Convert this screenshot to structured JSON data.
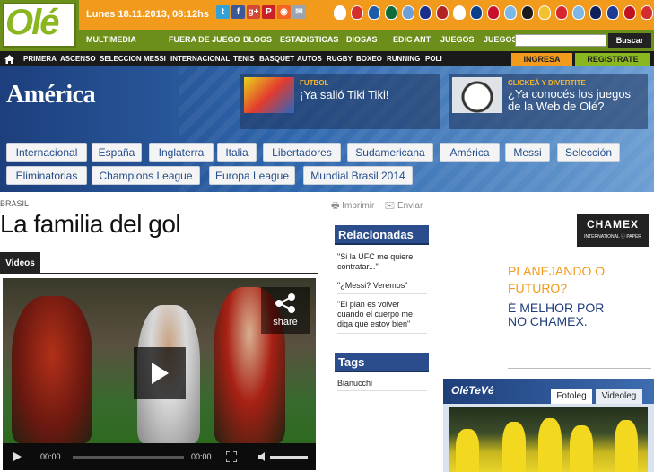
{
  "header": {
    "logo": "Olé",
    "date": "Lunes 18.11.2013, 08:12hs",
    "social_icons": [
      {
        "icon": "twitter-icon",
        "glyph": "t",
        "color": "#33a1d8"
      },
      {
        "icon": "facebook-icon",
        "glyph": "f",
        "color": "#3b5998"
      },
      {
        "icon": "google-plus-icon",
        "glyph": "g+",
        "color": "#d34836"
      },
      {
        "icon": "pinterest-icon",
        "glyph": "P",
        "color": "#cb2027"
      },
      {
        "icon": "rss-icon",
        "glyph": "◉",
        "color": "#f26522"
      },
      {
        "icon": "mail-icon",
        "glyph": "✉",
        "color": "#9aa4b1"
      }
    ],
    "crests": [
      "#ffffff",
      "#d62d2d",
      "#1b5caa",
      "#0f6c3a",
      "#6f9fd8",
      "#1a2f8a",
      "#b22222",
      "#ffffff",
      "#0b3f8c",
      "#c8102e",
      "#7ab8e8",
      "#1b1b1b",
      "#f2c12e",
      "#d7262e",
      "#7db7e6",
      "#0e1f5b",
      "#1f3a93",
      "#c1121f",
      "#d62d2d"
    ],
    "nav_primary": [
      "MULTIMEDIA",
      "FUERA DE JUEGO",
      "BLOGS",
      "ESTADISTICAS",
      "DIOSAS",
      "EDIC ANT",
      "JUEGOS",
      "JUEGOS"
    ],
    "search_button": "Buscar",
    "nav_secondary": [
      "PRIMERA",
      "ASCENSO",
      "SELECCION",
      "MESSI",
      "INTERNACIONAL",
      "TENIS",
      "BASQUET",
      "AUTOS",
      "RUGBY",
      "BOXEO",
      "RUNNING",
      "POLI"
    ],
    "ingresa": "INGRESA",
    "registrate": "REGISTRATE"
  },
  "banner": {
    "section": "América",
    "promo1": {
      "category": "FUTBOL",
      "title": "¡Ya salió Tiki Tiki!"
    },
    "promo2": {
      "category": "CLICKEÁ Y DIVERTITE",
      "title": "¿Ya conocés los juegos de la Web de Olé?"
    }
  },
  "tags_row1": [
    "Internacional",
    "España",
    "Inglaterra",
    "Italia",
    "Libertadores",
    "Sudamericana",
    "América",
    "Messi",
    "Selección"
  ],
  "tags_row2": [
    "Eliminatorias",
    "Champions League",
    "Europa League",
    "Mundial Brasil 2014"
  ],
  "article": {
    "kicker": "BRASIL",
    "headline": "La familia del gol",
    "tab": "Videos",
    "player": {
      "share_label": "share",
      "current_time": "00:00",
      "duration": "00:00"
    }
  },
  "sidebar": {
    "print": "Imprimir",
    "send": "Enviar",
    "related_title": "Relacionadas",
    "related": [
      "\"Si la UFC me quiere contratar...\"",
      "\"¿Messi? Veremos\"",
      "\"El plan es volver cuando el cuerpo me diga que estoy bien\""
    ],
    "tags_title": "Tags",
    "tags": [
      "Bianucchi"
    ]
  },
  "ad": {
    "brand": "CHAMEX",
    "brand_sub": "INTERNATIONAL ⓐ PAPER",
    "line1": "PLANEJANDO O FUTURO?",
    "line2": "É MELHOR POR NO CHAMEX."
  },
  "oleteve": {
    "logo": "OléTeVé",
    "tab_photo": "Fotoleg",
    "tab_video": "Videoleg"
  }
}
